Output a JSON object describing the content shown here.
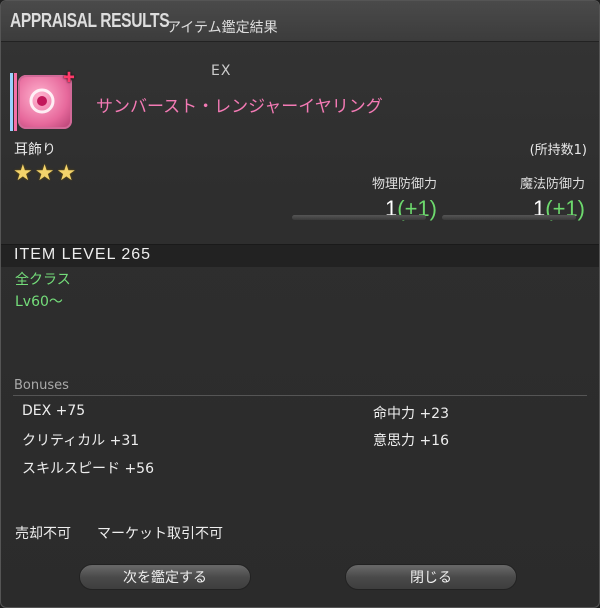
{
  "window": {
    "title_en": "APPRAISAL RESULTS",
    "title_jp": "アイテム鑑定結果"
  },
  "item": {
    "rarity_tag": "EX",
    "name": "サンバースト・レンジャーイヤリング",
    "name_color": "#f47ab5",
    "icon": "earring-icon",
    "category": "耳飾り",
    "owned": "(所持数1)",
    "stars": "★★★",
    "item_level": "ITEM LEVEL 265",
    "classes": "全クラス",
    "level": "Lv60～"
  },
  "stats": [
    {
      "label": "物理防御力",
      "value": "1",
      "bonus": "(+1)"
    },
    {
      "label": "魔法防御力",
      "value": "1",
      "bonus": "(+1)"
    }
  ],
  "bonuses": {
    "heading": "Bonuses",
    "items": [
      "DEX +75",
      "命中力 +23",
      "クリティカル +31",
      "意思力 +16",
      "スキルスピード +56"
    ]
  },
  "footer": {
    "unsellable": "売却不可",
    "no_market": "マーケット取引不可"
  },
  "buttons": {
    "next": "次を鑑定する",
    "close": "閉じる"
  }
}
